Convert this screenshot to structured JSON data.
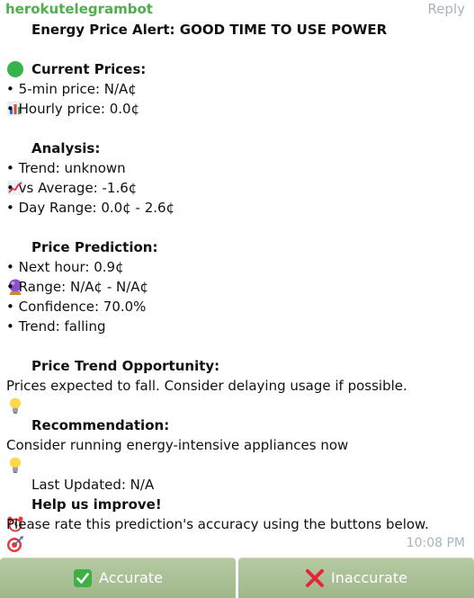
{
  "header": {
    "sender": "herokutelegrambot",
    "reply": "Reply"
  },
  "message": {
    "title": "Energy Price Alert: GOOD TIME TO USE POWER",
    "current_prices_heading": "Current Prices:",
    "five_min_price": "• 5-min price: N/A¢",
    "hourly_price": "• Hourly price: 0.0¢",
    "analysis_heading": "Analysis:",
    "trend": "• Trend: unknown",
    "vs_average": "• vs Average: -1.6¢",
    "day_range": "• Day Range: 0.0¢ - 2.6¢",
    "prediction_heading": "Price Prediction:",
    "next_hour": "• Next hour: 0.9¢",
    "range": "• Range: N/A¢ - N/A¢",
    "confidence": "• Confidence: 70.0%",
    "prediction_trend": "• Trend: falling",
    "opportunity_heading": "Price Trend Opportunity:",
    "opportunity_text": "Prices expected to fall. Consider delaying usage if possible.",
    "recommendation_heading": "Recommendation:",
    "recommendation_text": "Consider running energy-intensive appliances now",
    "last_updated": "Last Updated: N/A",
    "help_heading": "Help us improve!",
    "help_text": "Please rate this prediction's accuracy using the buttons below.",
    "timestamp": "10:08 PM"
  },
  "keyboard": {
    "accurate_label": "Accurate",
    "inaccurate_label": "Inaccurate"
  },
  "icons": {
    "title": "green-circle-icon",
    "current_prices": "bar-chart-icon",
    "analysis": "chart-increasing-icon",
    "prediction": "crystal-ball-icon",
    "opportunity": "light-bulb-icon",
    "recommendation": "light-bulb-icon",
    "last_updated": "alarm-clock-icon",
    "help": "direct-hit-icon",
    "accurate": "check-mark-button-icon",
    "inaccurate": "cross-mark-icon"
  },
  "colors": {
    "sender": "#4fae4e",
    "meta": "#a8b3bd",
    "keyboard_button": "#a9be94"
  }
}
